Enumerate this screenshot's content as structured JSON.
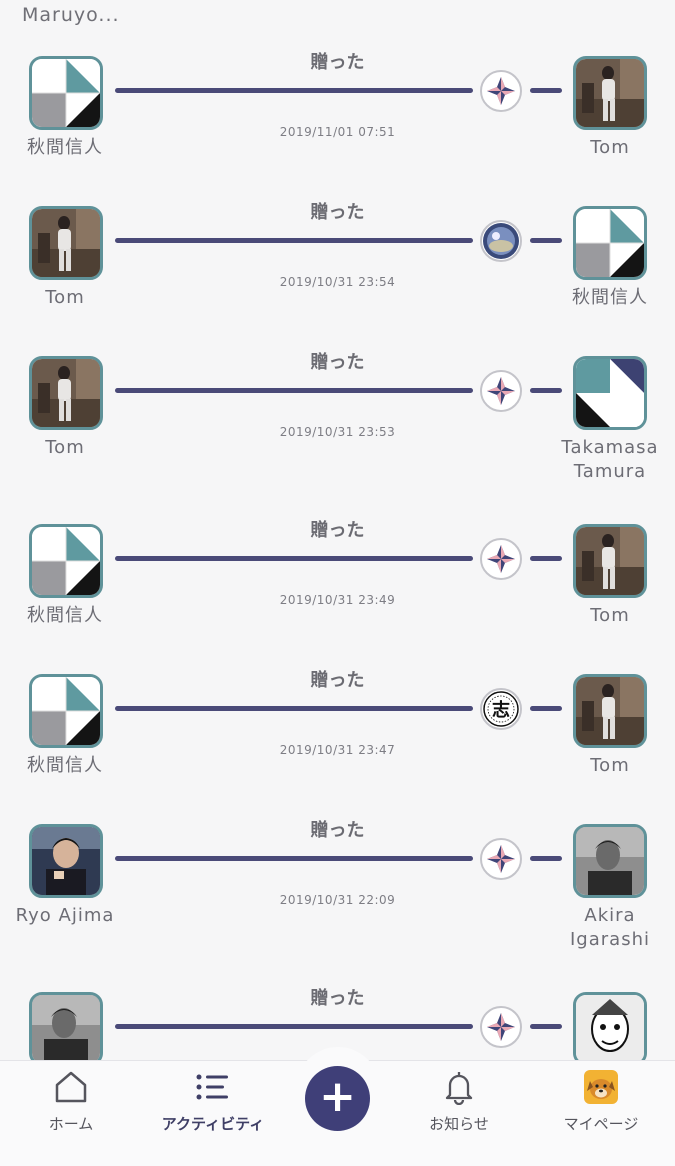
{
  "top_cut_name": "Maruyo...",
  "feed": [
    {
      "verb": "贈った",
      "time": "2019/11/01 07:51",
      "from": {
        "name": "秋間信人",
        "avatar": "geometric-logo"
      },
      "to": {
        "name": "Tom",
        "avatar": "photo-person"
      },
      "badge": "shuriken-icon"
    },
    {
      "verb": "贈った",
      "time": "2019/10/31 23:54",
      "from": {
        "name": "Tom",
        "avatar": "photo-person"
      },
      "to": {
        "name": "秋間信人",
        "avatar": "geometric-logo"
      },
      "badge": "globe-photo-icon"
    },
    {
      "verb": "贈った",
      "time": "2019/10/31 23:53",
      "from": {
        "name": "Tom",
        "avatar": "photo-person"
      },
      "to": {
        "name": "Takamasa Tamura",
        "avatar": "geometric-logo-2"
      },
      "badge": "shuriken-icon"
    },
    {
      "verb": "贈った",
      "time": "2019/10/31 23:49",
      "from": {
        "name": "秋間信人",
        "avatar": "geometric-logo"
      },
      "to": {
        "name": "Tom",
        "avatar": "photo-person"
      },
      "badge": "shuriken-icon"
    },
    {
      "verb": "贈った",
      "time": "2019/10/31 23:47",
      "from": {
        "name": "秋間信人",
        "avatar": "geometric-logo"
      },
      "to": {
        "name": "Tom",
        "avatar": "photo-person"
      },
      "badge": "kanji-stamp-icon"
    },
    {
      "verb": "贈った",
      "time": "2019/10/31 22:09",
      "from": {
        "name": "Ryo Ajima",
        "avatar": "photo-person-2"
      },
      "to": {
        "name": "Akira Igarashi",
        "avatar": "photo-person-3"
      },
      "badge": "shuriken-icon"
    },
    {
      "verb": "贈った",
      "time": "",
      "from": {
        "name": "",
        "avatar": "photo-person-3"
      },
      "to": {
        "name": "",
        "avatar": "illustration"
      },
      "badge": "shuriken-icon"
    }
  ],
  "stamp_char": "志",
  "tabbar": {
    "home": "ホーム",
    "activity": "アクティビティ",
    "plus": "+",
    "notifications": "お知らせ",
    "mypage": "マイページ"
  }
}
